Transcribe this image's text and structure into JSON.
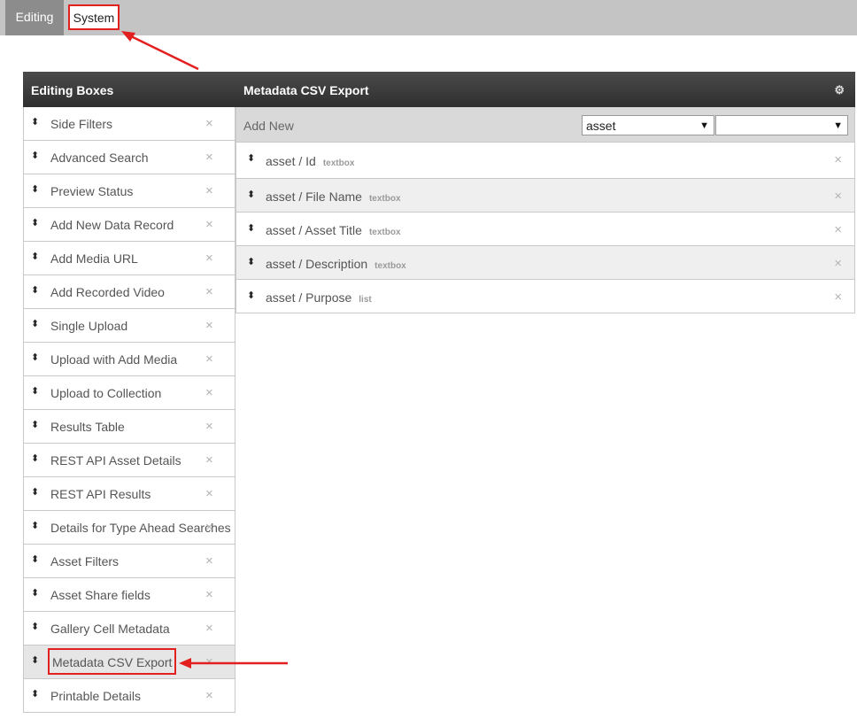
{
  "tabs": [
    {
      "label": "Editing"
    },
    {
      "label": "System"
    }
  ],
  "left_panel": {
    "title": "Editing Boxes",
    "items": [
      {
        "label": "Side Filters"
      },
      {
        "label": "Advanced Search"
      },
      {
        "label": "Preview Status"
      },
      {
        "label": "Add New Data Record"
      },
      {
        "label": "Add Media URL"
      },
      {
        "label": "Add Recorded Video"
      },
      {
        "label": "Single Upload"
      },
      {
        "label": "Upload with Add Media"
      },
      {
        "label": "Upload to Collection"
      },
      {
        "label": "Results Table"
      },
      {
        "label": "REST API Asset Details"
      },
      {
        "label": "REST API Results"
      },
      {
        "label": "Details for Type Ahead Searches"
      },
      {
        "label": "Asset Filters"
      },
      {
        "label": "Asset Share fields"
      },
      {
        "label": "Gallery Cell Metadata"
      },
      {
        "label": "Metadata CSV Export"
      },
      {
        "label": "Printable Details"
      }
    ],
    "close_symbol": "×",
    "drag_symbol": "⬍"
  },
  "right_panel": {
    "title": "Metadata CSV Export",
    "gear_symbol": "⚙",
    "add_new_label": "Add New",
    "select_asset_value": "asset",
    "select_field_value": "",
    "caret_symbol": "▼",
    "fields": [
      {
        "name": "asset / Id",
        "type": "textbox"
      },
      {
        "name": "asset / File Name",
        "type": "textbox"
      },
      {
        "name": "asset / Asset Title",
        "type": "textbox"
      },
      {
        "name": "asset / Description",
        "type": "textbox"
      },
      {
        "name": "asset / Purpose",
        "type": "list"
      }
    ]
  },
  "colors": {
    "header_dark": "#333333",
    "highlight_red": "#e32020",
    "topbar_gray": "#c4c4c4",
    "active_tab_gray": "#8c8c8c"
  }
}
